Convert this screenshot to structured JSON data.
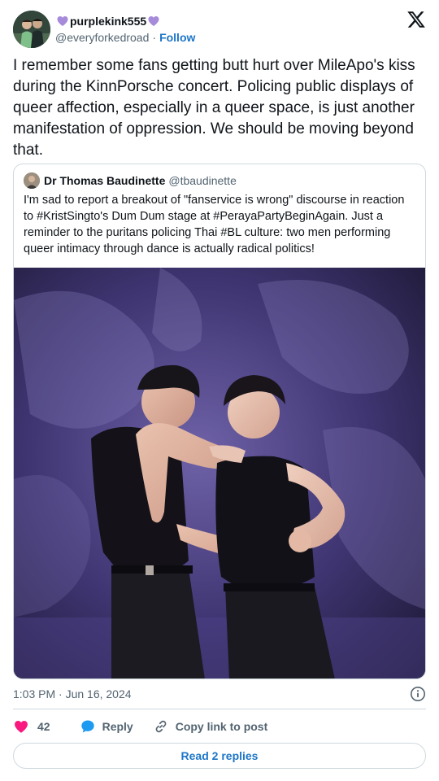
{
  "author": {
    "display_name": "purplekink555",
    "handle": "@everyforkedroad",
    "separator": "·",
    "follow_label": "Follow",
    "name_decoration_icon": "purple-heart-icon"
  },
  "platform_logo": "x-logo-icon",
  "tweet": {
    "text": "I remember some fans getting butt hurt over MileApo's kiss during the KinnPorsche concert. Policing public displays of queer affection, especially in a queer space, is just another manifestation of oppression. We should be moving beyond that.",
    "timestamp": "1:03 PM · Jun 16, 2024"
  },
  "quoted_tweet": {
    "display_name": "Dr Thomas Baudinette",
    "handle": "@tbaudinette",
    "text": "I'm sad to report a breakout of \"fanservice is wrong\" discourse in reaction to #KristSingto's Dum Dum stage at #PerayaPartyBeginAgain. Just a reminder to the puritans policing Thai #BL culture: two men performing queer intimacy through dance is actually radical politics!"
  },
  "actions": {
    "like_count": "42",
    "reply_label": "Reply",
    "copy_link_label": "Copy link to post",
    "read_replies_label": "Read 2 replies"
  },
  "colors": {
    "accent": "#1d75c8",
    "like": "#f91880",
    "reply": "#1d9bf0",
    "muted": "#536471",
    "border": "#cfd9de",
    "heart_emoji": "#a78bdb"
  }
}
